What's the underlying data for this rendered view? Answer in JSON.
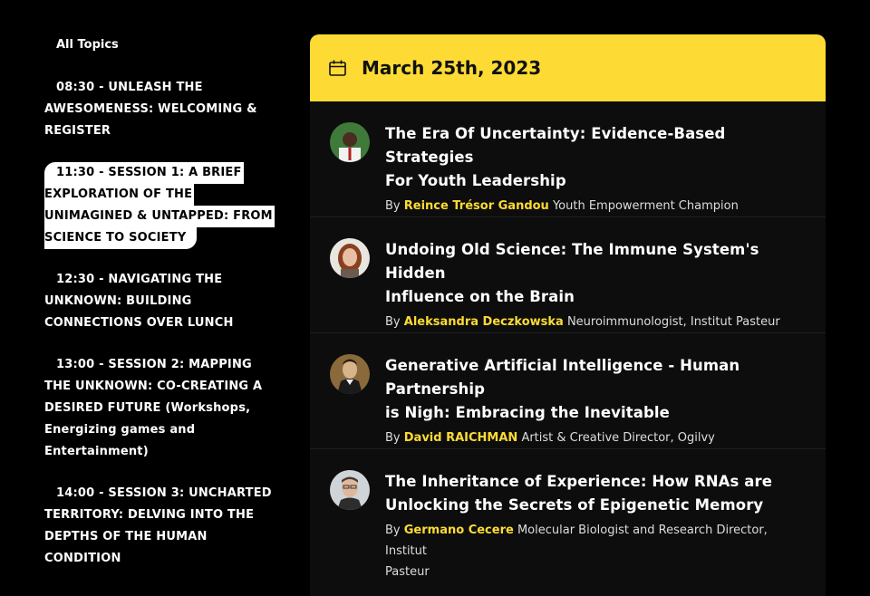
{
  "sidebar": {
    "all_topics": "All Topics",
    "topics": [
      {
        "lines": [
          "08:30 - UNLEASH THE",
          "AWESOMENESS: WELCOMING &",
          "REGISTER"
        ]
      },
      {
        "lines": [
          "11:30 - SESSION 1: A BRIEF",
          "EXPLORATION OF THE",
          "UNIMAGINED & UNTAPPED: FROM",
          "SCIENCE TO SOCIETY"
        ]
      },
      {
        "lines": [
          "12:30 - NAVIGATING THE",
          "UNKNOWN: BUILDING",
          "CONNECTIONS OVER LUNCH"
        ]
      },
      {
        "lines": [
          "13:00 - SESSION 2: MAPPING",
          "THE UNKNOWN: CO-CREATING A",
          "DESIRED FUTURE (Workshops,",
          "Energizing games and",
          "Entertainment)"
        ]
      },
      {
        "lines": [
          "14:00 - SESSION 3: UNCHARTED",
          "TERRITORY: DELVING INTO THE",
          "DEPTHS OF THE HUMAN",
          "CONDITION"
        ]
      }
    ]
  },
  "panel": {
    "date": "March 25th, 2023",
    "icon": "calendar-icon",
    "sessions": [
      {
        "title_lines": [
          "The Era Of Uncertainty: Evidence-Based Strategies",
          "For Youth Leadership"
        ],
        "by": "By",
        "speaker": "Reince Trésor Gandou",
        "role": "Youth Empowerment Champion"
      },
      {
        "title_lines": [
          "Undoing Old Science: The Immune System's Hidden",
          "Influence on the Brain"
        ],
        "by": "By",
        "speaker": "Aleksandra Deczkowska",
        "role": "Neuroimmunologist, Institut Pasteur"
      },
      {
        "title_lines": [
          "Generative Artificial Intelligence - Human Partnership",
          "is Nigh: Embracing the Inevitable"
        ],
        "by": "By",
        "speaker": "David RAICHMAN",
        "role": "Artist & Creative Director, Ogilvy"
      },
      {
        "title_lines": [
          "The Inheritance of Experience: How RNAs are",
          "Unlocking the Secrets of Epigenetic Memory"
        ],
        "by": "By",
        "speaker": "Germano Cecere",
        "role_lines": [
          "Molecular Biologist and Research Director, Institut",
          "Pasteur"
        ]
      }
    ]
  },
  "colors": {
    "accent": "#fddb34",
    "background": "#000000",
    "panel": "#0d0d0d"
  }
}
